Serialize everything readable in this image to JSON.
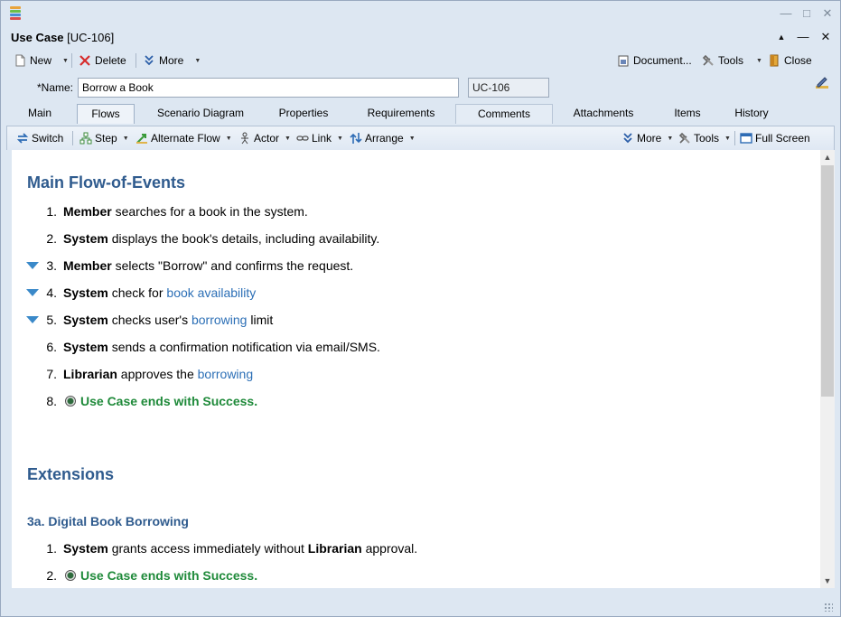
{
  "window": {
    "title_bold": "Use Case",
    "title_id": "[UC-106]"
  },
  "toolbar": {
    "new_label": "New",
    "delete_label": "Delete",
    "more_label": "More",
    "document_label": "Document...",
    "tools_label": "Tools",
    "close_label": "Close"
  },
  "form": {
    "name_label": "*Name:",
    "name_value": "Borrow a Book",
    "id_value": "UC-106"
  },
  "tabs": [
    {
      "label": "Main"
    },
    {
      "label": "Flows"
    },
    {
      "label": "Scenario Diagram"
    },
    {
      "label": "Properties"
    },
    {
      "label": "Requirements"
    },
    {
      "label": "Comments"
    },
    {
      "label": "Attachments"
    },
    {
      "label": "Items"
    },
    {
      "label": "History"
    }
  ],
  "flow_toolbar": {
    "switch_label": "Switch",
    "step_label": "Step",
    "alternate_flow_label": "Alternate Flow",
    "actor_label": "Actor",
    "link_label": "Link",
    "arrange_label": "Arrange",
    "more_label": "More",
    "tools_label": "Tools",
    "fullscreen_label": "Full Screen"
  },
  "main_flow": {
    "heading": "Main Flow-of-Events",
    "steps": [
      {
        "num": "1.",
        "actor": "Member",
        "text": " searches for a book in the system."
      },
      {
        "num": "2.",
        "actor": "System",
        "text": " displays the book's details, including availability."
      },
      {
        "num": "3.",
        "actor": "Member",
        "text": " selects \"Borrow\" and confirms the request."
      },
      {
        "num": "4.",
        "actor": "System",
        "text": " check for ",
        "link": "book availability"
      },
      {
        "num": "5.",
        "actor": "System",
        "text": " checks user's ",
        "link": "borrowing",
        "after": " limit"
      },
      {
        "num": "6.",
        "actor": "System",
        "text": " sends a confirmation notification via email/SMS."
      },
      {
        "num": "7.",
        "actor": "Librarian",
        "text": " approves the ",
        "link": "borrowing"
      },
      {
        "num": "8.",
        "success": "Use Case ends with Success."
      }
    ]
  },
  "extensions": {
    "heading": "Extensions",
    "sub_heading": "3a. Digital Book Borrowing",
    "steps": [
      {
        "num": "1.",
        "actor": "System",
        "text": " grants access immediately without ",
        "actor2": "Librarian",
        "after": " approval."
      },
      {
        "num": "2.",
        "success": "Use Case ends with Success."
      }
    ]
  }
}
